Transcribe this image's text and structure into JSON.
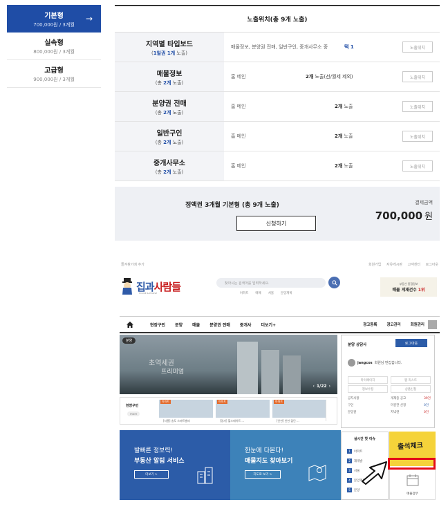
{
  "plans": [
    {
      "name": "기본형",
      "price": "700,000원 / 3개월",
      "active": true
    },
    {
      "name": "실속형",
      "price": "800,000원 / 3개월"
    },
    {
      "name": "고급형",
      "price": "900,000원 / 3개월"
    }
  ],
  "table": {
    "header": "노출위치(총 9개 노출)",
    "button_label": "노출위치",
    "rows": [
      {
        "title": "지역별 타입보드",
        "sub_pre": "(",
        "sub_strong": "1일권 1개",
        "sub_post": " 노출)",
        "position": "매물정보, 분양권 전매, 일반구인, 중개사무소 중",
        "count_strong": "택 1",
        "count_post": ""
      },
      {
        "title": "매물정보",
        "sub_pre": "(총 ",
        "sub_strong": "2개",
        "sub_post": " 노출)",
        "position": "홈 메인",
        "count_strong": "2개",
        "count_post": " 노출(선/월세 제외)"
      },
      {
        "title": "분양권 전매",
        "sub_pre": "(총 ",
        "sub_strong": "2개",
        "sub_post": " 노출)",
        "position": "홈 메인",
        "count_strong": "2개",
        "count_post": " 노출"
      },
      {
        "title": "일반구인",
        "sub_pre": "(총 ",
        "sub_strong": "2개",
        "sub_post": " 노출)",
        "position": "홈 메인",
        "count_strong": "2개",
        "count_post": " 노출"
      },
      {
        "title": "중개사무소",
        "sub_pre": "(총 ",
        "sub_strong": "2개",
        "sub_post": " 노출)",
        "position": "홈 메인",
        "count_strong": "2개",
        "count_post": " 노출"
      }
    ]
  },
  "summary": {
    "title": "정액권 3개월 기본형 (총 9개 노출)",
    "apply_label": "신청하기",
    "price_label": "결제금액",
    "price": "700,000",
    "currency": "원"
  },
  "site": {
    "topbar_left": "즐겨찾기에 추가",
    "topbar_right": [
      "회원가입",
      "자유게시판",
      "고객센터",
      "로그아웃"
    ],
    "logo_a": "집과",
    "logo_b": "사람들",
    "logo_sub": "HOUSE & PEOPLE",
    "search_placeholder": "찾아시는 검색어를 입력하세요.",
    "keywords": [
      "아파트",
      "매매",
      "서울",
      "분양계획"
    ],
    "top_banner_1": "부동산 종합정보",
    "top_banner_2a": "매물 게재건수 ",
    "top_banner_2b": "1위",
    "gnb": [
      "현장구인",
      "분양",
      "매물",
      "분양권 전매",
      "중개사",
      "더보기+"
    ],
    "gnb_right": [
      "광고등록",
      "광고관리",
      "회원관리"
    ],
    "hero_tag": "분양",
    "hero_text1": "초역세권",
    "hero_text2": "프리미엄",
    "hero_pager": "1/22",
    "sub_label": "현장구인",
    "sub_more": "more",
    "thumbs": [
      {
        "tag": "아파트",
        "label": "[서울] 송도 스마트밸리"
      },
      {
        "tag": "아파트",
        "label": "[경기] 힐스테이트 ..."
      },
      {
        "tag": "아파트",
        "label": "[인천] 인천 검단 ..."
      }
    ],
    "banner1_l1": "발빠른 정보력!",
    "banner1_l2": "부동산 알림 서비스",
    "banner1_btn": "더보기 >",
    "banner2_l1": "한눈에 다본다!",
    "banner2_l2": "매물지도 찾아보기",
    "banner2_btn": "지도로 보기 >",
    "login_title": "분양 상담사",
    "logout_label": "로그아웃",
    "user_id": "jangcos",
    "welcome_text": "회원님 반갑습니다.",
    "login_cells": [
      "마이페이지",
      "찜 리스트",
      "정보수정",
      "상품신청"
    ],
    "stats": [
      "공지사항",
      "게재중 공고",
      "구인",
      "마감한 신청",
      "분양권",
      "저녁엔"
    ],
    "stat_values": [
      "39건",
      "0건",
      "0건"
    ],
    "issue_title": "실시간 핫 이슈",
    "issues": [
      "아파트",
      "재개발",
      "서울",
      "분양계획",
      "분양"
    ],
    "attend_label": "출석체크",
    "ledger_label": "매물장부"
  }
}
